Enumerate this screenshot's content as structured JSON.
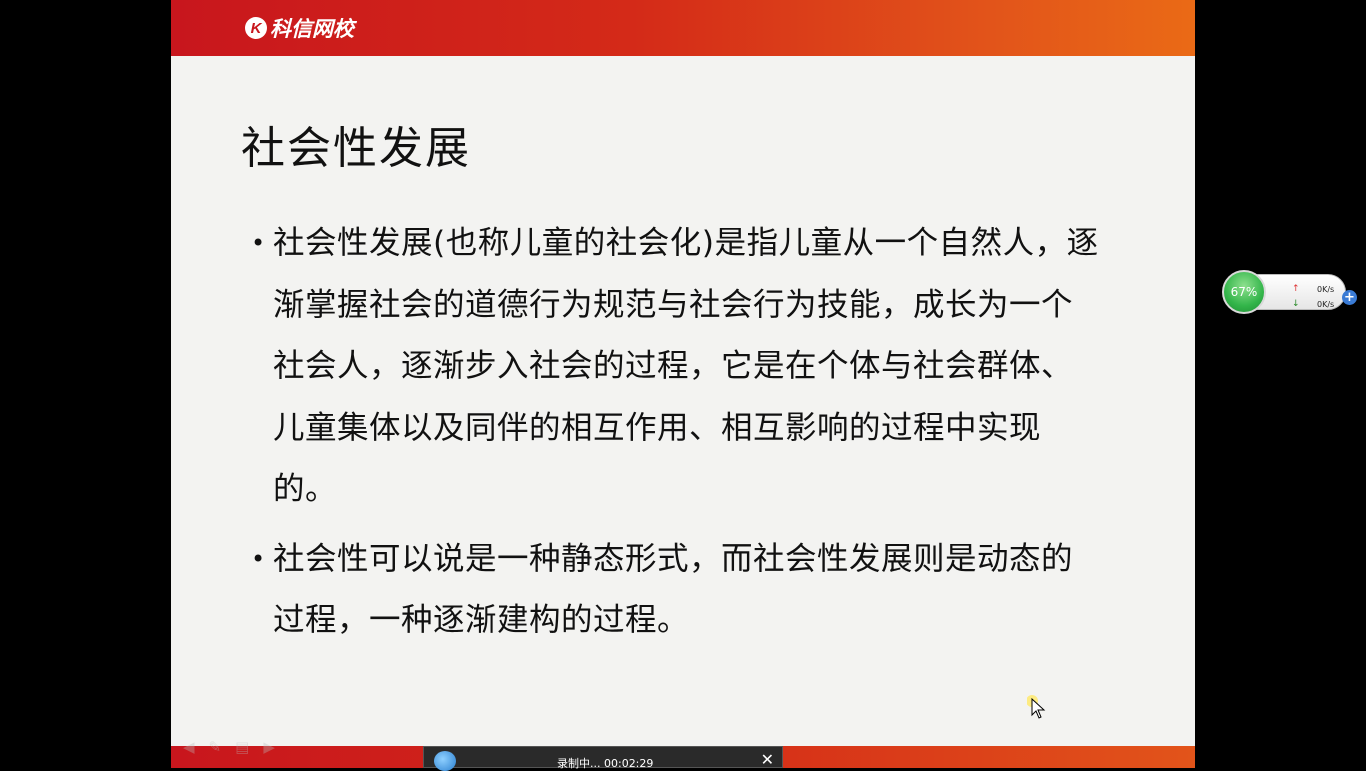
{
  "header": {
    "logo_mark": "K",
    "logo_text": "科信网校"
  },
  "slide": {
    "title": "社会性发展",
    "bullets": [
      {
        "symbol": "•",
        "text": "社会性发展(也称儿童的社会化)是指儿童从一个自然人，逐渐掌握社会的道德行为规范与社会行为技能，成长为一个社会人，逐渐步入社会的过程，它是在个体与社会群体、儿童集体以及同伴的相互作用、相互影响的过程中实现的。"
      },
      {
        "symbol": "•",
        "text": "社会性可以说是一种静态形式，而社会性发展则是动态的过程，一种逐渐建构的过程。"
      }
    ]
  },
  "recorder": {
    "status": "录制中...  00:02:29",
    "close": "✕"
  },
  "net_widget": {
    "percent": "67%",
    "up_speed": "0K/s",
    "down_speed": "0K/s",
    "up_arrow": "↑",
    "down_arrow": "↓",
    "plus": "+"
  },
  "colors": {
    "brand_red": "#c8161d",
    "brand_orange": "#ea6a16",
    "slide_bg": "#f3f3f1"
  }
}
